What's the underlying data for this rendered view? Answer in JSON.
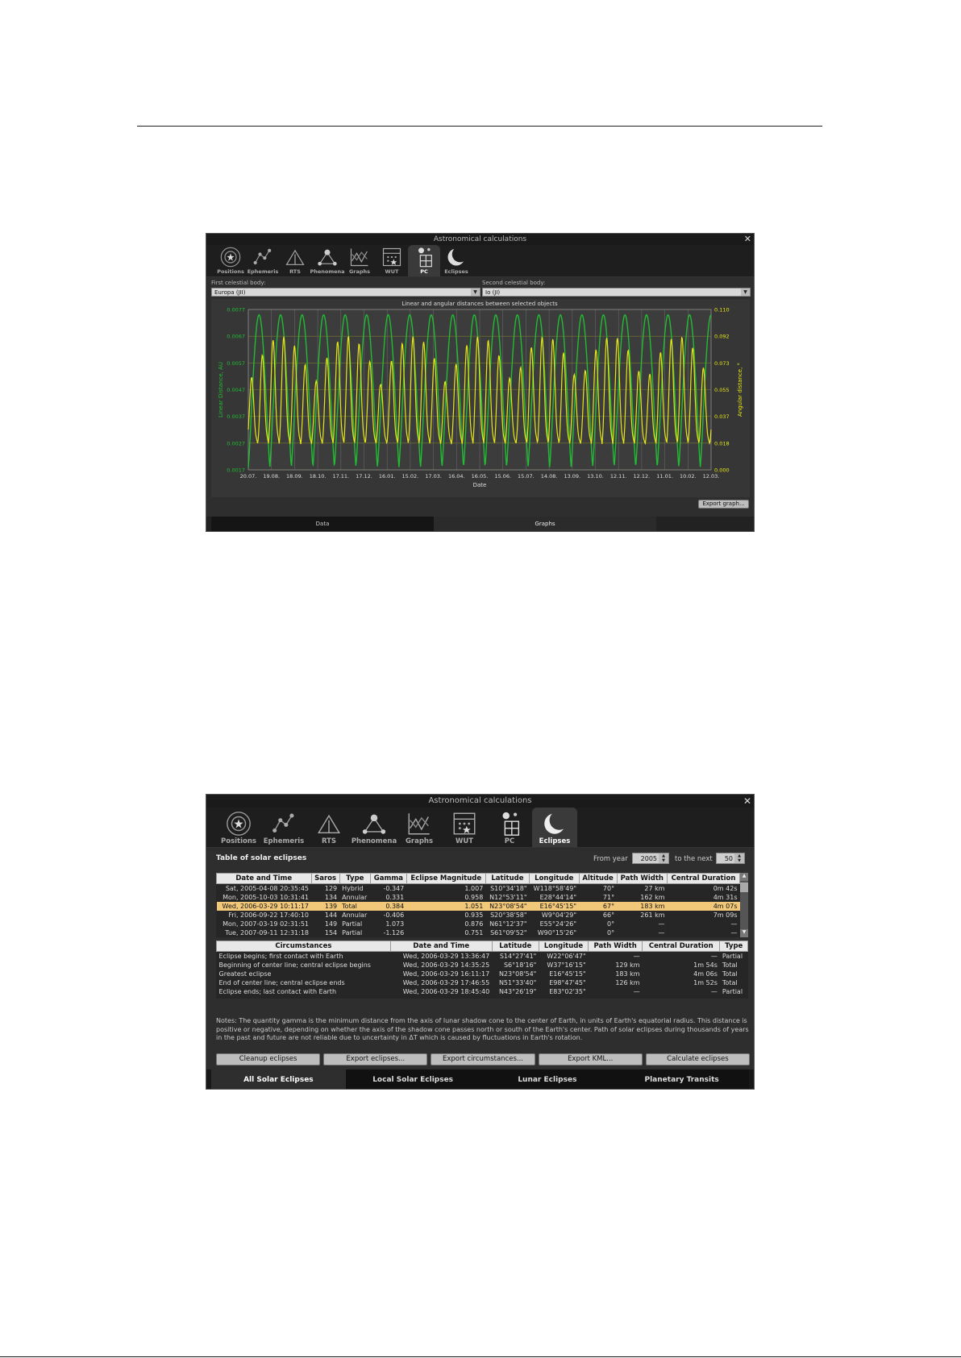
{
  "window1": {
    "title": "Astronomical calculations",
    "tabs": [
      {
        "label": "Positions",
        "icon": "positions-icon"
      },
      {
        "label": "Ephemeris",
        "icon": "ephemeris-icon"
      },
      {
        "label": "RTS",
        "icon": "rts-icon"
      },
      {
        "label": "Phenomena",
        "icon": "phenomena-icon"
      },
      {
        "label": "Graphs",
        "icon": "graphs-icon"
      },
      {
        "label": "WUT",
        "icon": "wut-icon"
      },
      {
        "label": "PC",
        "icon": "pc-icon"
      },
      {
        "label": "Eclipses",
        "icon": "eclipses-icon"
      }
    ],
    "active_tab": "PC",
    "first_body_label": "First celestial body:",
    "first_body_value": "Europa (JII)",
    "second_body_label": "Second celestial body:",
    "second_body_value": "Io (JI)",
    "export_graph": "Export graph...",
    "bottom_tabs": [
      "Data",
      "Graphs"
    ]
  },
  "chart_data": {
    "type": "line",
    "title": "Linear and angular distances between selected objects",
    "xlabel": "Date",
    "ylabel": "Linear Distance, AU",
    "ylabel_right": "Angular distance, °",
    "x_ticks": [
      "20.07.",
      "19.08.",
      "18.09.",
      "18.10.",
      "17.11.",
      "17.12.",
      "16.01.",
      "15.02.",
      "17.03.",
      "16.04.",
      "16.05.",
      "15.06.",
      "15.07.",
      "14.08.",
      "13.09.",
      "13.10.",
      "12.11.",
      "12.12.",
      "11.01.",
      "10.02.",
      "12.03."
    ],
    "y_left_ticks": [
      "0.0077",
      "0.0067",
      "0.0057",
      "0.0047",
      "0.0037",
      "0.0027",
      "0.0017"
    ],
    "y_right_ticks": [
      "0.110",
      "0.092",
      "0.073",
      "0.055",
      "0.037",
      "0.018",
      "0.000"
    ],
    "ylim": [
      0.0017,
      0.0077
    ],
    "ylim_right": [
      0.0,
      0.11
    ],
    "grid": true,
    "series": [
      {
        "color": "#22bb33",
        "cycles": 21.5,
        "min": 0.0018,
        "max": 0.0075
      },
      {
        "color": "#e6e619",
        "min": 0.004,
        "max": 0.095
      }
    ]
  },
  "window2": {
    "title": "Astronomical calculations",
    "tabs": [
      {
        "label": "Positions",
        "icon": "positions-icon"
      },
      {
        "label": "Ephemeris",
        "icon": "ephemeris-icon"
      },
      {
        "label": "RTS",
        "icon": "rts-icon"
      },
      {
        "label": "Phenomena",
        "icon": "phenomena-icon"
      },
      {
        "label": "Graphs",
        "icon": "graphs-icon"
      },
      {
        "label": "WUT",
        "icon": "wut-icon"
      },
      {
        "label": "PC",
        "icon": "pc-icon"
      },
      {
        "label": "Eclipses",
        "icon": "eclipses-icon"
      }
    ],
    "active_tab": "Eclipses",
    "table_title": "Table of solar eclipses",
    "from_year_label": "From year",
    "from_year_value": "2005",
    "to_next_label": "to the next",
    "to_next_value": "50",
    "eclipse_headers": [
      "Date and Time",
      "Saros",
      "Type",
      "Gamma",
      "Eclipse Magnitude",
      "Latitude",
      "Longitude",
      "Altitude",
      "Path Width",
      "Central Duration"
    ],
    "eclipse_rows": [
      [
        "Sat, 2005-04-08 20:35:45",
        "129",
        "Hybrid",
        "-0.347",
        "1.007",
        "S10°34'18\"",
        "W118°58'49\"",
        "70°",
        "27 km",
        "0m 42s"
      ],
      [
        "Mon, 2005-10-03 10:31:41",
        "134",
        "Annular",
        "0.331",
        "0.958",
        "N12°53'11\"",
        "E28°44'14\"",
        "71°",
        "162 km",
        "4m 31s"
      ],
      [
        "Wed, 2006-03-29 10:11:17",
        "139",
        "Total",
        "0.384",
        "1.051",
        "N23°08'54\"",
        "E16°45'15\"",
        "67°",
        "183 km",
        "4m 07s"
      ],
      [
        "Fri, 2006-09-22 17:40:10",
        "144",
        "Annular",
        "-0.406",
        "0.935",
        "S20°38'58\"",
        "W9°04'29\"",
        "66°",
        "261 km",
        "7m 09s"
      ],
      [
        "Mon, 2007-03-19 02:31:51",
        "149",
        "Partial",
        "1.073",
        "0.876",
        "N61°12'37\"",
        "E55°24'26\"",
        "0°",
        "—",
        "—"
      ],
      [
        "Tue, 2007-09-11 12:31:18",
        "154",
        "Partial",
        "-1.126",
        "0.751",
        "S61°09'52\"",
        "W90°15'26\"",
        "0°",
        "—",
        "—"
      ]
    ],
    "selected_row": 2,
    "circ_headers": [
      "Circumstances",
      "Date and Time",
      "Latitude",
      "Longitude",
      "Path Width",
      "Central Duration",
      "Type"
    ],
    "circ_rows": [
      [
        "Eclipse begins; first contact with Earth",
        "Wed, 2006-03-29 13:36:47",
        "S14°27'41\"",
        "W22°06'47\"",
        "—",
        "—",
        "Partial"
      ],
      [
        "Beginning of center line; central eclipse begins",
        "Wed, 2006-03-29 14:35:25",
        "S6°18'16\"",
        "W37°16'15\"",
        "129 km",
        "1m 54s",
        "Total"
      ],
      [
        "Greatest eclipse",
        "Wed, 2006-03-29 16:11:17",
        "N23°08'54\"",
        "E16°45'15\"",
        "183 km",
        "4m 06s",
        "Total"
      ],
      [
        "End of center line; central eclipse ends",
        "Wed, 2006-03-29 17:46:55",
        "N51°33'40\"",
        "E98°47'45\"",
        "126 km",
        "1m 52s",
        "Total"
      ],
      [
        "Eclipse ends; last contact with Earth",
        "Wed, 2006-03-29 18:45:40",
        "N43°26'19\"",
        "E83°02'35\"",
        "—",
        "—",
        "Partial"
      ]
    ],
    "notes": "Notes: The quantity gamma is the minimum distance from the axis of lunar shadow cone to the center of Earth, in units of Earth's equatorial radius. This distance is positive or negative, depending on whether the axis of the shadow cone passes north or south of the Earth's center. Path of solar eclipses during thousands of years in the past and future are not reliable due to uncertainty in ΔT which is caused by fluctuations in Earth's rotation.",
    "buttons": [
      "Cleanup eclipses",
      "Export eclipses...",
      "Export circumstances...",
      "Export KML...",
      "Calculate eclipses"
    ],
    "bottom_tabs": [
      "All Solar Eclipses",
      "Local Solar Eclipses",
      "Lunar Eclipses",
      "Planetary Transits"
    ]
  },
  "colors": {
    "green": "#22bb33",
    "yellow": "#e6e619",
    "selection": "#f1c87a"
  }
}
